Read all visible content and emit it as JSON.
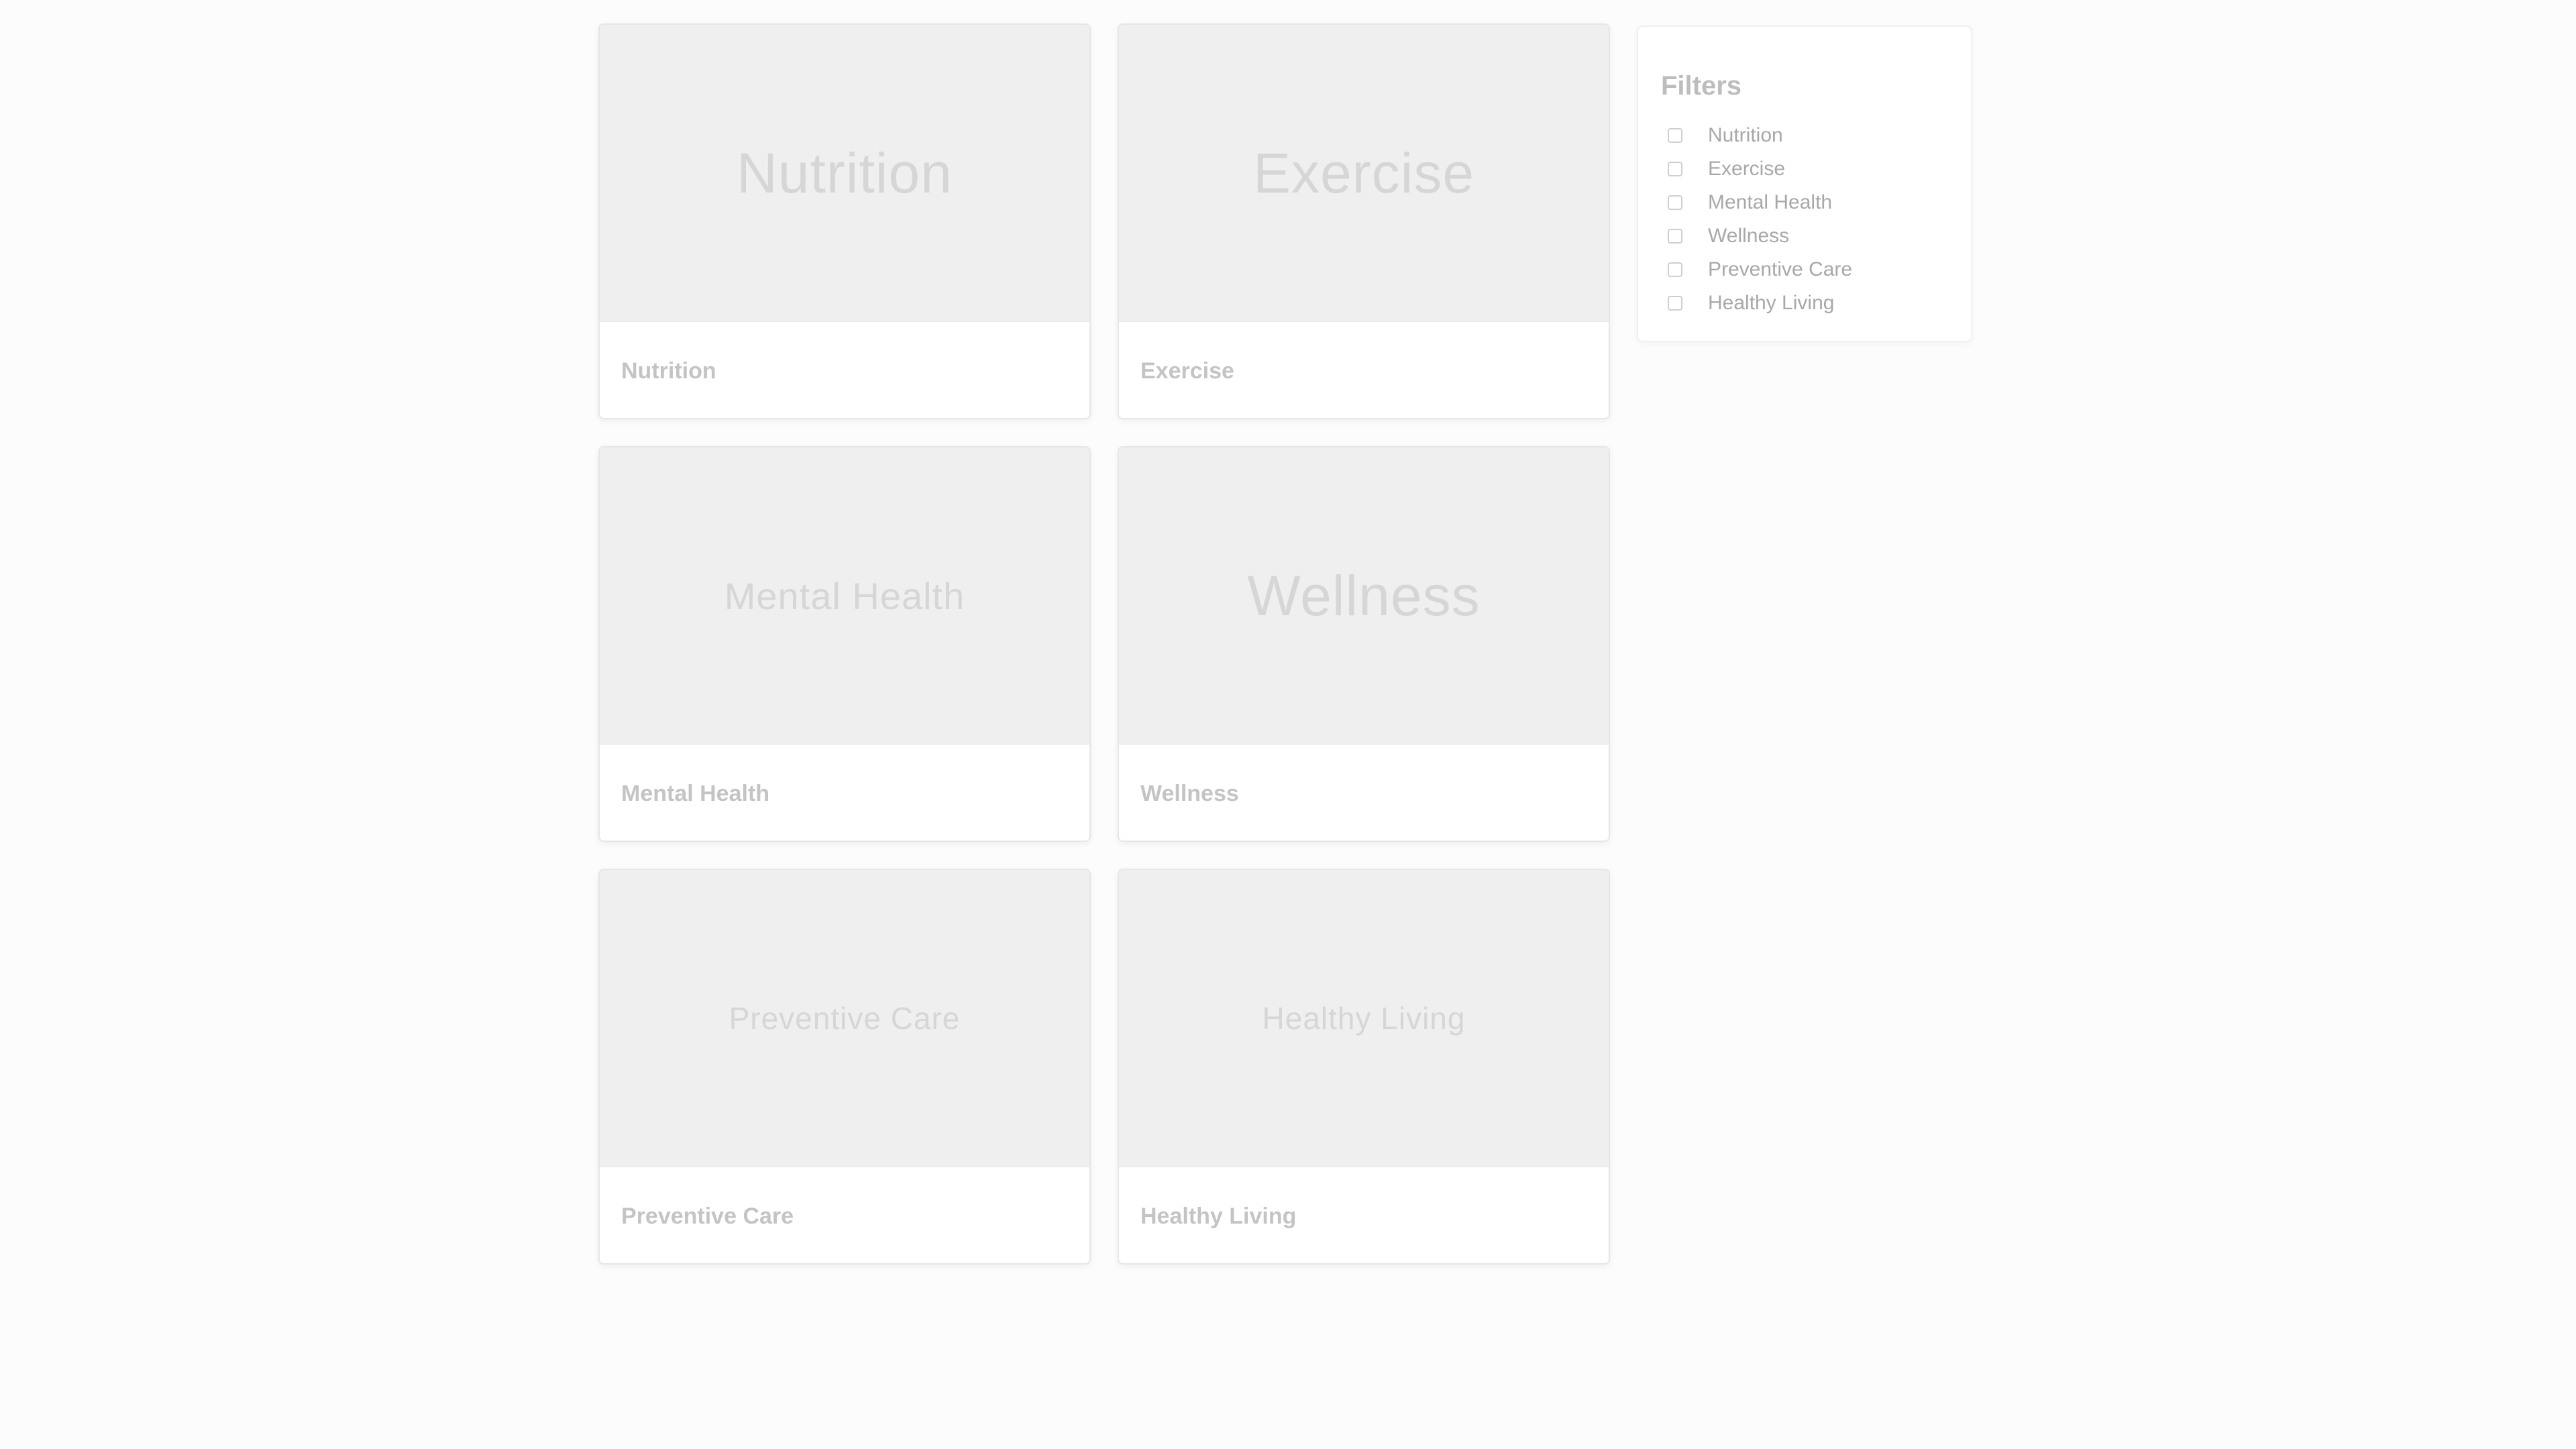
{
  "cards": [
    {
      "image_text": "Nutrition",
      "title": "Nutrition"
    },
    {
      "image_text": "Exercise",
      "title": "Exercise"
    },
    {
      "image_text": "Mental Health",
      "title": "Mental Health"
    },
    {
      "image_text": "Wellness",
      "title": "Wellness"
    },
    {
      "image_text": "Preventive Care",
      "title": "Preventive Care"
    },
    {
      "image_text": "Healthy Living",
      "title": "Healthy Living"
    }
  ],
  "filters": {
    "title": "Filters",
    "options": [
      {
        "label": "Nutrition",
        "checked": false
      },
      {
        "label": "Exercise",
        "checked": false
      },
      {
        "label": "Mental Health",
        "checked": false
      },
      {
        "label": "Wellness",
        "checked": false
      },
      {
        "label": "Preventive Care",
        "checked": false
      },
      {
        "label": "Healthy Living",
        "checked": false
      }
    ]
  },
  "colors": {
    "background": "#fcfcfc",
    "image_placeholder": "#efefef",
    "muted_text": "#c4c4c4"
  }
}
